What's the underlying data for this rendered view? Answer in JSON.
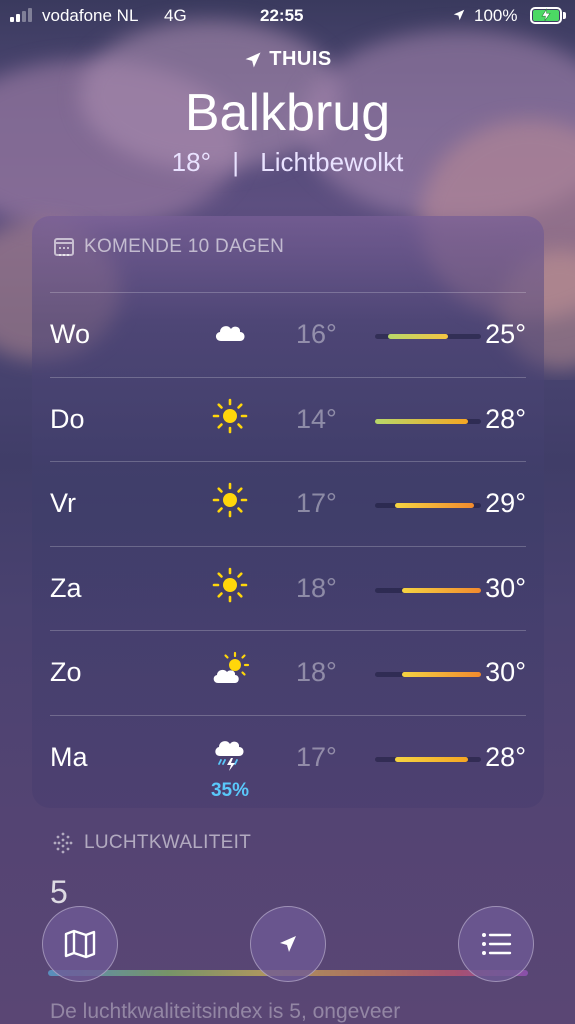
{
  "status_bar": {
    "carrier": "vodafone NL",
    "network": "4G",
    "time": "22:55",
    "battery": "100%",
    "signal_bars": 2
  },
  "header": {
    "location_label": "THUIS",
    "city": "Balkbrug",
    "temperature": "18°",
    "separator": "|",
    "condition": "Lichtbewolkt"
  },
  "forecast": {
    "title": "KOMENDE 10 DAGEN",
    "scale_min": 14,
    "scale_max": 30,
    "days": [
      {
        "day": "Wo",
        "icon": "cloud-icon",
        "low": "16°",
        "high": "25°",
        "low_val": 16,
        "high_val": 25,
        "precip": ""
      },
      {
        "day": "Do",
        "icon": "sun-icon",
        "low": "14°",
        "high": "28°",
        "low_val": 14,
        "high_val": 28,
        "precip": ""
      },
      {
        "day": "Vr",
        "icon": "sun-icon",
        "low": "17°",
        "high": "29°",
        "low_val": 17,
        "high_val": 29,
        "precip": ""
      },
      {
        "day": "Za",
        "icon": "sun-icon",
        "low": "18°",
        "high": "30°",
        "low_val": 18,
        "high_val": 30,
        "precip": ""
      },
      {
        "day": "Zo",
        "icon": "partly-cloudy-icon",
        "low": "18°",
        "high": "30°",
        "low_val": 18,
        "high_val": 30,
        "precip": ""
      },
      {
        "day": "Ma",
        "icon": "thunderstorm-icon",
        "low": "17°",
        "high": "28°",
        "low_val": 17,
        "high_val": 28,
        "precip": "35%"
      }
    ]
  },
  "air_quality": {
    "title": "LUCHTKWALITEIT",
    "value": "5",
    "description": "De luchtkwaliteitsindex is 5, ongeveer"
  },
  "toolbar": {
    "map_icon": "map-icon",
    "location_icon": "location-arrow-icon",
    "list_icon": "list-icon"
  },
  "colors": {
    "precip": "#5ac8fa",
    "battery": "#4cd964",
    "sun": "#ffd60a"
  }
}
